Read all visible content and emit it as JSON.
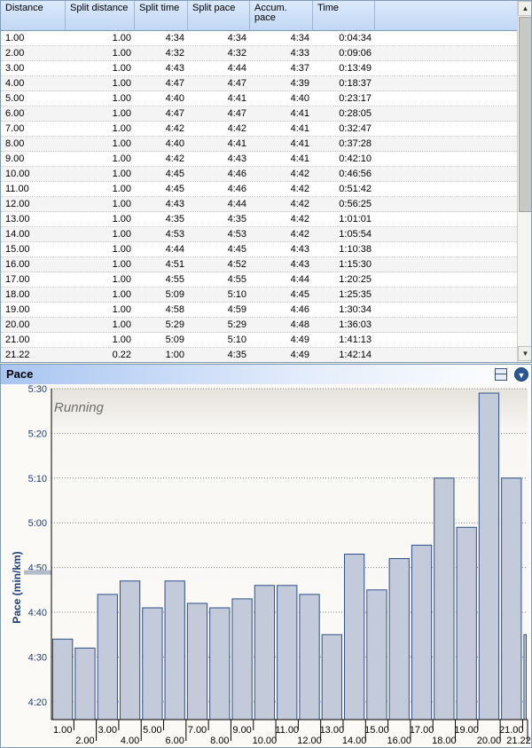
{
  "table": {
    "columns": [
      "Distance",
      "Split distance",
      "Split time",
      "Split pace",
      "Accum.\npace",
      "Time"
    ],
    "rows": [
      [
        "1.00",
        "1.00",
        "4:34",
        "4:34",
        "4:34",
        "0:04:34"
      ],
      [
        "2.00",
        "1.00",
        "4:32",
        "4:32",
        "4:33",
        "0:09:06"
      ],
      [
        "3.00",
        "1.00",
        "4:43",
        "4:44",
        "4:37",
        "0:13:49"
      ],
      [
        "4.00",
        "1.00",
        "4:47",
        "4:47",
        "4:39",
        "0:18:37"
      ],
      [
        "5.00",
        "1.00",
        "4:40",
        "4:41",
        "4:40",
        "0:23:17"
      ],
      [
        "6.00",
        "1.00",
        "4:47",
        "4:47",
        "4:41",
        "0:28:05"
      ],
      [
        "7.00",
        "1.00",
        "4:42",
        "4:42",
        "4:41",
        "0:32:47"
      ],
      [
        "8.00",
        "1.00",
        "4:40",
        "4:41",
        "4:41",
        "0:37:28"
      ],
      [
        "9.00",
        "1.00",
        "4:42",
        "4:43",
        "4:41",
        "0:42:10"
      ],
      [
        "10.00",
        "1.00",
        "4:45",
        "4:46",
        "4:42",
        "0:46:56"
      ],
      [
        "11.00",
        "1.00",
        "4:45",
        "4:46",
        "4:42",
        "0:51:42"
      ],
      [
        "12.00",
        "1.00",
        "4:43",
        "4:44",
        "4:42",
        "0:56:25"
      ],
      [
        "13.00",
        "1.00",
        "4:35",
        "4:35",
        "4:42",
        "1:01:01"
      ],
      [
        "14.00",
        "1.00",
        "4:53",
        "4:53",
        "4:42",
        "1:05:54"
      ],
      [
        "15.00",
        "1.00",
        "4:44",
        "4:45",
        "4:43",
        "1:10:38"
      ],
      [
        "16.00",
        "1.00",
        "4:51",
        "4:52",
        "4:43",
        "1:15:30"
      ],
      [
        "17.00",
        "1.00",
        "4:55",
        "4:55",
        "4:44",
        "1:20:25"
      ],
      [
        "18.00",
        "1.00",
        "5:09",
        "5:10",
        "4:45",
        "1:25:35"
      ],
      [
        "19.00",
        "1.00",
        "4:58",
        "4:59",
        "4:46",
        "1:30:34"
      ],
      [
        "20.00",
        "1.00",
        "5:29",
        "5:29",
        "4:48",
        "1:36:03"
      ],
      [
        "21.00",
        "1.00",
        "5:09",
        "5:10",
        "4:49",
        "1:41:13"
      ],
      [
        "21.22",
        "0.22",
        "1:00",
        "4:35",
        "4:49",
        "1:42:14"
      ]
    ]
  },
  "icons": {
    "scroll_up": "scroll-up-arrow",
    "scroll_down": "scroll-down-arrow",
    "layout": "layout-icon",
    "menu": "chevron-down-circle-icon"
  },
  "chart_panel": {
    "title": "Pace"
  },
  "chart_data": {
    "type": "bar",
    "annotation": "Running",
    "ylabel": "Pace (min/km)",
    "xlabel": "",
    "ylim_minutes": [
      4.2667,
      5.5
    ],
    "yticks": [
      "4:20",
      "4:30",
      "4:40",
      "4:50",
      "5:00",
      "5:10",
      "5:20",
      "5:30"
    ],
    "ytick_values": [
      4.3333,
      4.5,
      4.6667,
      4.8333,
      5.0,
      5.1667,
      5.3333,
      5.5
    ],
    "average_marker_minutes": 4.8167,
    "xtick_labels": [
      "1.00",
      "2.00",
      "3.00",
      "4.00",
      "5.00",
      "6.00",
      "7.00",
      "8.00",
      "9.00",
      "10.00",
      "11.00",
      "12.00",
      "13.00",
      "14.00",
      "15.00",
      "16.00",
      "17.00",
      "18.00",
      "19.00",
      "20.00",
      "21.00",
      "21.22"
    ],
    "bins": [
      {
        "start": 0.0,
        "end": 1.0,
        "pace": "4:34",
        "minutes": 4.5667
      },
      {
        "start": 1.0,
        "end": 2.0,
        "pace": "4:32",
        "minutes": 4.5333
      },
      {
        "start": 2.0,
        "end": 3.0,
        "pace": "4:44",
        "minutes": 4.7333
      },
      {
        "start": 3.0,
        "end": 4.0,
        "pace": "4:47",
        "minutes": 4.7833
      },
      {
        "start": 4.0,
        "end": 5.0,
        "pace": "4:41",
        "minutes": 4.6833
      },
      {
        "start": 5.0,
        "end": 6.0,
        "pace": "4:47",
        "minutes": 4.7833
      },
      {
        "start": 6.0,
        "end": 7.0,
        "pace": "4:42",
        "minutes": 4.7
      },
      {
        "start": 7.0,
        "end": 8.0,
        "pace": "4:41",
        "minutes": 4.6833
      },
      {
        "start": 8.0,
        "end": 9.0,
        "pace": "4:43",
        "minutes": 4.7167
      },
      {
        "start": 9.0,
        "end": 10.0,
        "pace": "4:46",
        "minutes": 4.7667
      },
      {
        "start": 10.0,
        "end": 11.0,
        "pace": "4:46",
        "minutes": 4.7667
      },
      {
        "start": 11.0,
        "end": 12.0,
        "pace": "4:44",
        "minutes": 4.7333
      },
      {
        "start": 12.0,
        "end": 13.0,
        "pace": "4:35",
        "minutes": 4.5833
      },
      {
        "start": 13.0,
        "end": 14.0,
        "pace": "4:53",
        "minutes": 4.8833
      },
      {
        "start": 14.0,
        "end": 15.0,
        "pace": "4:45",
        "minutes": 4.75
      },
      {
        "start": 15.0,
        "end": 16.0,
        "pace": "4:52",
        "minutes": 4.8667
      },
      {
        "start": 16.0,
        "end": 17.0,
        "pace": "4:55",
        "minutes": 4.9167
      },
      {
        "start": 17.0,
        "end": 18.0,
        "pace": "5:10",
        "minutes": 5.1667
      },
      {
        "start": 18.0,
        "end": 19.0,
        "pace": "4:59",
        "minutes": 4.9833
      },
      {
        "start": 19.0,
        "end": 20.0,
        "pace": "5:29",
        "minutes": 5.4833
      },
      {
        "start": 20.0,
        "end": 21.0,
        "pace": "5:10",
        "minutes": 5.1667
      },
      {
        "start": 21.0,
        "end": 21.22,
        "pace": "4:35",
        "minutes": 4.5833
      }
    ],
    "colors": {
      "bar_fill": "#c3cbdb",
      "bar_stroke": "#2e4f8a",
      "axis": "#000000",
      "ytick_text": "#1f3f7a",
      "ylabel": "#1f3f7a",
      "grid": "#808080",
      "marker": "#b4bccc"
    },
    "grid": true
  }
}
